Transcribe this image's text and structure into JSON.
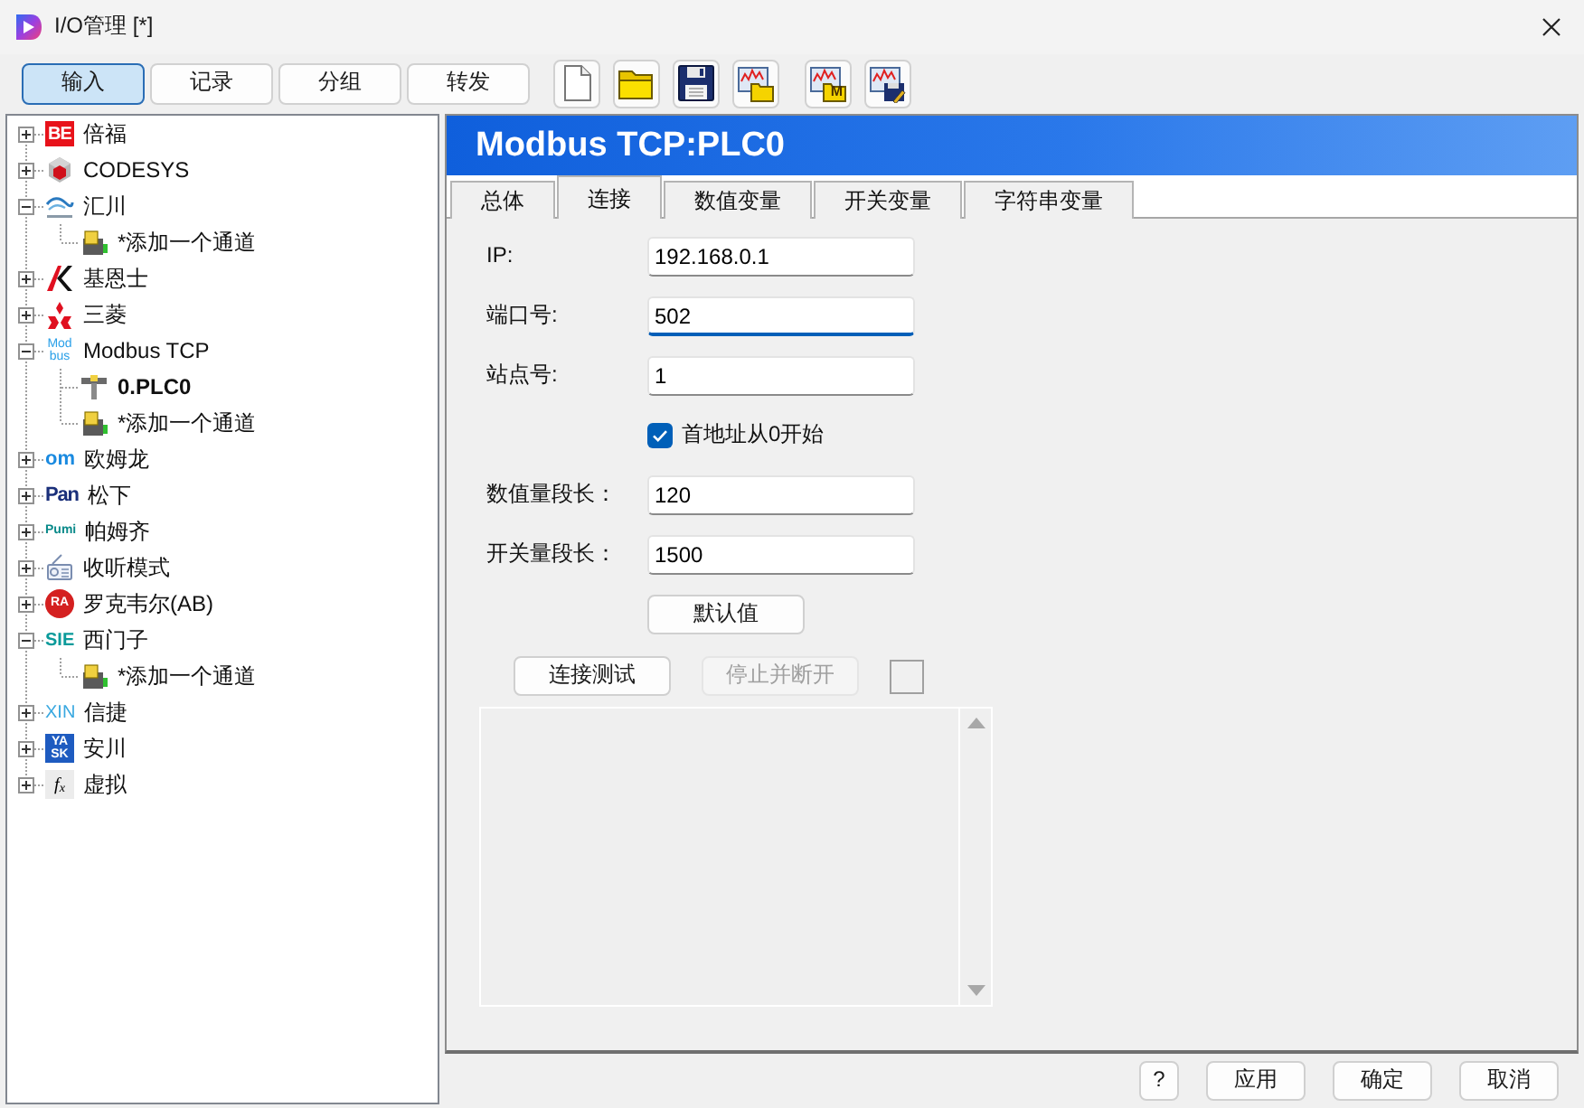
{
  "window": {
    "title": "I/O管理 [*]"
  },
  "mode_tabs": [
    {
      "label": "输入",
      "selected": true
    },
    {
      "label": "记录",
      "selected": false
    },
    {
      "label": "分组",
      "selected": false
    },
    {
      "label": "转发",
      "selected": false
    }
  ],
  "tool_groups": [
    [
      {
        "kind": "new"
      },
      {
        "kind": "open"
      },
      {
        "kind": "save"
      },
      {
        "kind": "chart-open"
      }
    ],
    [
      {
        "kind": "chart-open",
        "badge": "M"
      },
      {
        "kind": "chart-save"
      }
    ]
  ],
  "tree": [
    {
      "label": "倍福",
      "logo": [
        "BE"
      ],
      "expanded": false,
      "selected": false
    },
    {
      "label": "CODESYS",
      "expanded": false,
      "selected": false
    },
    {
      "label": "汇川",
      "expanded": true,
      "selected": false,
      "children": [
        {
          "kind": "add",
          "label": "*添加一个通道",
          "selected": false
        }
      ]
    },
    {
      "label": "基恩士",
      "expanded": false,
      "selected": false
    },
    {
      "label": "三菱",
      "expanded": false,
      "selected": false
    },
    {
      "label": "Modbus TCP",
      "logo": [
        "Mod",
        "bus"
      ],
      "expanded": true,
      "selected": false,
      "children": [
        {
          "kind": "device",
          "label": "0.PLC0",
          "selected": true
        },
        {
          "kind": "add",
          "label": "*添加一个通道",
          "selected": false
        }
      ]
    },
    {
      "label": "欧姆龙",
      "logo": [
        "om"
      ],
      "expanded": false,
      "selected": false
    },
    {
      "label": "松下",
      "logo": [
        "Pan"
      ],
      "expanded": false,
      "selected": false
    },
    {
      "label": "帕姆齐",
      "logo": [
        "Pumi"
      ],
      "expanded": false,
      "selected": false
    },
    {
      "label": "收听模式",
      "expanded": false,
      "selected": false
    },
    {
      "label": "罗克韦尔(AB)",
      "logo": [
        "RA"
      ],
      "expanded": false,
      "selected": false
    },
    {
      "label": "西门子",
      "logo": [
        "SIE"
      ],
      "expanded": true,
      "selected": false,
      "children": [
        {
          "kind": "add",
          "label": "*添加一个通道",
          "selected": false
        }
      ]
    },
    {
      "label": "信捷",
      "logo": [
        "XIN"
      ],
      "expanded": false,
      "selected": false
    },
    {
      "label": "安川",
      "logo": [
        "YA",
        "SK"
      ],
      "expanded": false,
      "selected": false
    },
    {
      "label": "虚拟",
      "logo": [
        "f$_{x}$"
      ],
      "expanded": false,
      "selected": false
    }
  ],
  "panel": {
    "title": "Modbus TCP:PLC0",
    "tabs": [
      {
        "label": "总体",
        "selected": false
      },
      {
        "label": "连接",
        "selected": true
      },
      {
        "label": "数值变量",
        "selected": false
      },
      {
        "label": "开关变量",
        "selected": false
      },
      {
        "label": "字符串变量",
        "selected": false
      }
    ],
    "fields": [
      {
        "kind": "input",
        "label": "IP:",
        "value": "192.168.0.1",
        "focused": false
      },
      {
        "kind": "input",
        "label": "端口号:",
        "value": "502",
        "focused": true
      },
      {
        "kind": "input",
        "label": "站点号:",
        "value": "1",
        "focused": false
      },
      {
        "kind": "checkbox",
        "label": "首地址从0开始",
        "checked": true
      },
      {
        "kind": "input",
        "label": "数值量段长：",
        "value": "120",
        "focused": false
      },
      {
        "kind": "input",
        "label": "开关量段长：",
        "value": "1500",
        "focused": false
      }
    ],
    "default_button": "默认值",
    "test_buttons": [
      {
        "label": "连接测试",
        "disabled": false
      },
      {
        "label": "停止并断开",
        "disabled": true
      }
    ]
  },
  "dialog_buttons": [
    "?",
    "应用",
    "确定",
    "取消"
  ]
}
